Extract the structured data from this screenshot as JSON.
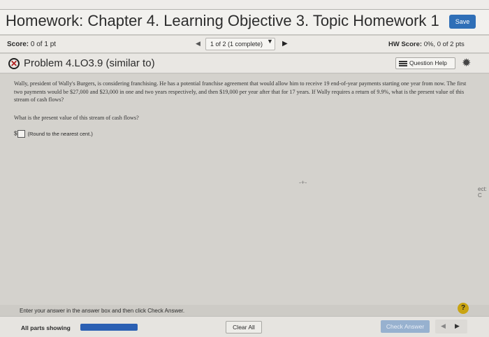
{
  "header": {
    "title": "Homework: Chapter 4. Learning Objective 3. Topic Homework 1",
    "save_label": "Save"
  },
  "scorebar": {
    "score_label": "Score:",
    "score_value": "0 of 1 pt",
    "question_nav": "1 of 2 (1 complete)",
    "hw_score_label": "HW Score:",
    "hw_score_value": "0%, 0 of 2 pts"
  },
  "problem": {
    "status_icon": "x-circle-icon",
    "title": "Problem 4.LO3.9 (similar to)",
    "question_help_label": "Question Help",
    "text": "Wally, president of Wally's Burgers, is considering franchising. He has a potential franchise agreement that would allow him to receive 19 end-of-year payments starting one year from now. The first two payments would be $27,000 and $23,000 in one and two years respectively, and then $19,000 per year after that for 17 years. If Wally requires a return of 9.9%, what is the present value of this stream of cash flows?",
    "question": "What is the present value of this stream of cash flows?",
    "answer_currency": "$",
    "answer_value": "",
    "answer_note": "(Round to the nearest cent.)"
  },
  "edge": {
    "mark": "-+-",
    "text": "ect: C"
  },
  "footer": {
    "instruction": "Enter your answer in the answer box and then click Check Answer.",
    "help_symbol": "?",
    "parts_label": "All parts showing",
    "progress": 1.0,
    "clear_label": "Clear All",
    "check_label": "Check Answer"
  },
  "colors": {
    "accent": "#2f6fb7",
    "progress": "#2a5fb3",
    "error": "#b01a1a"
  }
}
